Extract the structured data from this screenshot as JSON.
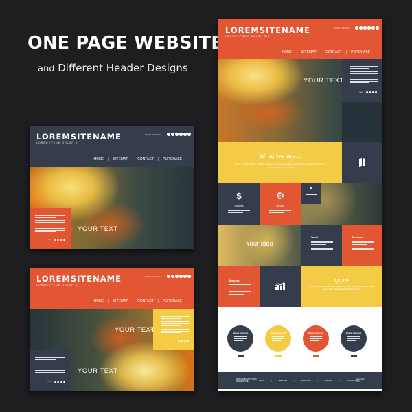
{
  "headline": {
    "title": "ONE PAGE WEBSITE",
    "subtitle_and": "and",
    "subtitle_rest": "Different Header Designs"
  },
  "colors": {
    "background": "#1e1e20",
    "navy": "#353d4c",
    "orange": "#e35634",
    "yellow": "#f4cb45"
  },
  "site": {
    "logo": "LOREMSITENAME",
    "tagline": "LOREM IPSUM DOLOR SIT",
    "contact": "DATA / CONTACT",
    "social_icons": [
      "social-icon",
      "social-icon",
      "social-icon",
      "social-icon",
      "social-icon",
      "social-icon"
    ],
    "nav": [
      "HOME",
      "SITEMAP",
      "CONTACT",
      "PURCHASE"
    ],
    "nav_separator": "|"
  },
  "mockup_a": {
    "header_color": "navy",
    "hero_text": "YOUR TEXT",
    "textbox_color": "orange",
    "textbox_dots_label": "more"
  },
  "mockup_b": {
    "header_color": "orange",
    "hero_text_1": "YOUR TEXT",
    "hero_text_2": "YOUR TEXT",
    "textbox1_color": "yellow",
    "textbox2_color": "navy",
    "dots_label": "more"
  },
  "mockup_c": {
    "header_color": "orange",
    "hero_text": "YOUR TEXT",
    "dots_label": "more",
    "what_we_are": {
      "title": "What we are...",
      "text": "Donec ut pretium nulla. Praesent sagittis, ipsum eget feugiat convallis, purus diam pretium ligula, et molestie tortor ligula sed lorem."
    },
    "book_icon": "book-icon",
    "tiles": {
      "success": {
        "label": "Success",
        "icon": "dollar-icon"
      },
      "service": {
        "label": "Service",
        "icon": "gear-icon"
      },
      "small": {
        "label": "Lorem ipsum",
        "icon": "shapes-icon"
      }
    },
    "your_idea": "Your idea",
    "travel": {
      "title": "Travel"
    },
    "business_1": {
      "title": "Business"
    },
    "business_2": {
      "title": "Business"
    },
    "chart_icon": "bar-chart-icon",
    "quote": {
      "title": "Quote",
      "text": "Donec ut pretium nulla. Praesent sagittis, ipsum eget feugiat convallis, purus diam pretium ligula, et molestie tortor ligula sed lorem."
    },
    "circles": [
      {
        "title": "Sample lorem text",
        "color": "navy",
        "button": "more"
      },
      {
        "title": "Sample lorem text",
        "color": "yellow",
        "button": "more"
      },
      {
        "title": "Sample lorem text",
        "color": "orange",
        "button": "more"
      },
      {
        "title": "Sample lorem text",
        "color": "navy",
        "button": "more"
      }
    ],
    "footer": {
      "left": "WWW.SAMPLESITE.COM  |  @SAMPLESITE",
      "links": [
        "ABOUT",
        "SERVICES",
        "SOLUTIONS",
        "SUPPORT",
        "CONTACTS"
      ],
      "copyright": "Copyright © 2015"
    }
  }
}
